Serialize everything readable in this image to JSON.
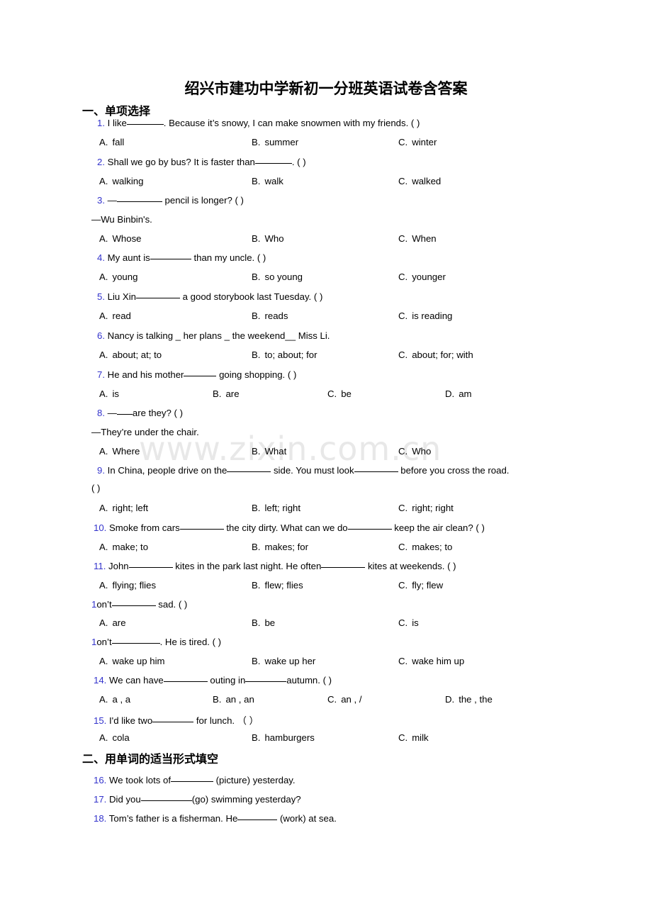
{
  "document": {
    "title": "绍兴市建功中学新初一分班英语试卷含答案",
    "watermark": "www.zixin.com.cn",
    "number_color": "#3333cc",
    "text_color": "#000000"
  },
  "sections": [
    {
      "heading": "一、单项选择"
    },
    {
      "heading": "二、用单词的适当形式填空"
    }
  ],
  "questions": [
    {
      "num": "1.",
      "text_before": "I like",
      "text_after": ". Because it’s snowy, I can make snowmen with my friends. (    )",
      "options": [
        {
          "label": "A.",
          "value": "fall"
        },
        {
          "label": "B.",
          "value": "summer"
        },
        {
          "label": "C.",
          "value": "winter"
        }
      ]
    },
    {
      "num": "2.",
      "text_before": "Shall we go by bus? It is faster than",
      "text_after": ". (   )",
      "options": [
        {
          "label": "A.",
          "value": "walking"
        },
        {
          "label": "B.",
          "value": "walk"
        },
        {
          "label": "C.",
          "value": "walked"
        }
      ]
    },
    {
      "num": "3.",
      "text_before": "—",
      "text_after": " pencil is longer? (   )",
      "continuation": "—Wu Binbin's.",
      "options": [
        {
          "label": "A.",
          "value": "Whose"
        },
        {
          "label": "B.",
          "value": "Who"
        },
        {
          "label": "C.",
          "value": "When"
        }
      ]
    },
    {
      "num": "4.",
      "text_before": "My aunt is",
      "text_after": " than my uncle. (   )",
      "options": [
        {
          "label": "A.",
          "value": "young"
        },
        {
          "label": "B.",
          "value": "so young"
        },
        {
          "label": "C.",
          "value": "younger"
        }
      ]
    },
    {
      "num": "5.",
      "text_before": "Liu Xin",
      "text_after": " a good storybook last Tuesday. (   )",
      "options": [
        {
          "label": "A.",
          "value": "read"
        },
        {
          "label": "B.",
          "value": "reads"
        },
        {
          "label": "C.",
          "value": "is reading"
        }
      ]
    },
    {
      "num": "6.",
      "full_text": "Nancy is talking _ her plans _ the weekend__ Miss Li.",
      "options": [
        {
          "label": "A.",
          "value": "about; at; to"
        },
        {
          "label": "B.",
          "value": "to; about; for"
        },
        {
          "label": "C.",
          "value": "about; for; with"
        }
      ]
    },
    {
      "num": "7.",
      "text_before": "He and his mother",
      "text_after": " going shopping. (   )",
      "options": [
        {
          "label": "A.",
          "value": "is"
        },
        {
          "label": "B.",
          "value": "are"
        },
        {
          "label": "C.",
          "value": "be"
        },
        {
          "label": "D.",
          "value": "am"
        }
      ]
    },
    {
      "num": "8.",
      "text_before": "—",
      "text_after": "are they? (   )",
      "continuation": "—They’re under the chair.",
      "options": [
        {
          "label": "A.",
          "value": "Where"
        },
        {
          "label": "B.",
          "value": "What"
        },
        {
          "label": "C.",
          "value": "Who"
        }
      ]
    },
    {
      "num": "9.",
      "text_before": "In China, people drive on the",
      "text_mid": " side. You must look",
      "text_after": " before you cross the road.",
      "continuation": "(   )",
      "options": [
        {
          "label": "A.",
          "value": "right; left"
        },
        {
          "label": "B.",
          "value": "left; right"
        },
        {
          "label": "C.",
          "value": "right; right"
        }
      ]
    },
    {
      "num": "10.",
      "text_before": "Smoke from cars",
      "text_mid": " the city dirty. What can we do",
      "text_after": " keep the air clean? (    )",
      "options": [
        {
          "label": "A.",
          "value": "make; to"
        },
        {
          "label": "B.",
          "value": "makes; for"
        },
        {
          "label": "C.",
          "value": "makes; to"
        }
      ]
    },
    {
      "num": "11.",
      "text_before": "John",
      "text_mid": " kites in the park last night. He often",
      "text_after": " kites at weekends. (    )",
      "options": [
        {
          "label": "A.",
          "value": "flying; flies"
        },
        {
          "label": "B.",
          "value": "flew; flies"
        },
        {
          "label": "C.",
          "value": "fly; flew"
        }
      ]
    },
    {
      "num": "1",
      "text_before": "on’t",
      "text_after": " sad. (   )",
      "options": [
        {
          "label": "A.",
          "value": "are"
        },
        {
          "label": "B.",
          "value": "be"
        },
        {
          "label": "C.",
          "value": "is"
        }
      ]
    },
    {
      "num": "1",
      "text_before": "on’t",
      "text_after": ". He is tired. (   )",
      "options": [
        {
          "label": "A.",
          "value": "wake up him"
        },
        {
          "label": "B.",
          "value": "wake up her"
        },
        {
          "label": "C.",
          "value": "wake him up"
        }
      ]
    },
    {
      "num": "14.",
      "text_before": "We can have",
      "text_mid": " outing in",
      "text_after": "autumn. (   )",
      "options": [
        {
          "label": "A.",
          "value": "a , a"
        },
        {
          "label": "B.",
          "value": "an , an"
        },
        {
          "label": "C.",
          "value": "an , /"
        },
        {
          "label": "D.",
          "value": "the , the"
        }
      ]
    },
    {
      "num": "15.",
      "text_before": "I'd like two",
      "text_after": " for lunch.  （    ）",
      "options": [
        {
          "label": "A.",
          "value": "cola"
        },
        {
          "label": "B.",
          "value": "hamburgers"
        },
        {
          "label": "C.",
          "value": "milk"
        }
      ]
    },
    {
      "num": "16.",
      "text_before": "We took lots of",
      "text_after": " (picture) yesterday."
    },
    {
      "num": "17.",
      "text_before": "Did you",
      "text_after": "(go) swimming yesterday?"
    },
    {
      "num": "18.",
      "text_before": "Tom’s father is a fisherman. He",
      "text_after": " (work) at sea."
    }
  ]
}
